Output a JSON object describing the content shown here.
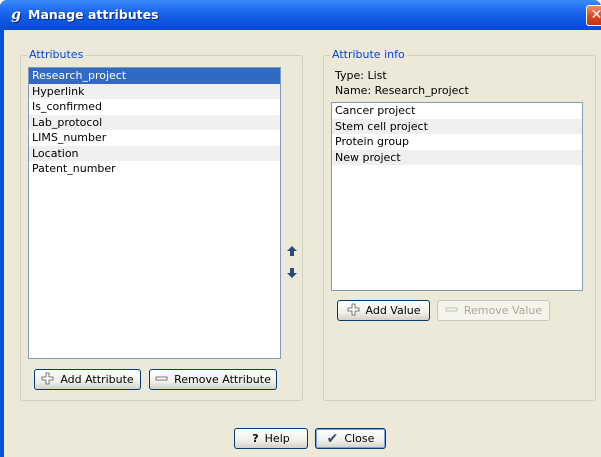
{
  "window": {
    "title": "Manage attributes",
    "app_icon_glyph": "g",
    "close_glyph": "✕"
  },
  "attributes_group": {
    "title": "Attributes",
    "items": [
      "Research_project",
      "Hyperlink",
      "Is_confirmed",
      "Lab_protocol",
      "LIMS_number",
      "Location",
      "Patent_number"
    ],
    "selected_index": 0,
    "add_button": "Add Attribute",
    "remove_button": "Remove Attribute"
  },
  "move_controls": {
    "up_icon": "arrow-up-icon",
    "down_icon": "arrow-down-icon"
  },
  "info_group": {
    "title": "Attribute info",
    "type_line": "Type: List",
    "name_line": "Name: Research_project",
    "values": [
      "Cancer project",
      "Stem cell project",
      "Protein group",
      "New project"
    ],
    "add_button": "Add Value",
    "remove_button": "Remove Value",
    "remove_enabled": false
  },
  "footer": {
    "help_button": "Help",
    "help_icon_glyph": "?",
    "close_button": "Close",
    "close_icon_glyph": "✔"
  },
  "colors": {
    "title_bar": "#1f6af0",
    "selection": "#316ac5",
    "group_title": "#0046d5",
    "dialog_bg": "#ece9d8"
  }
}
